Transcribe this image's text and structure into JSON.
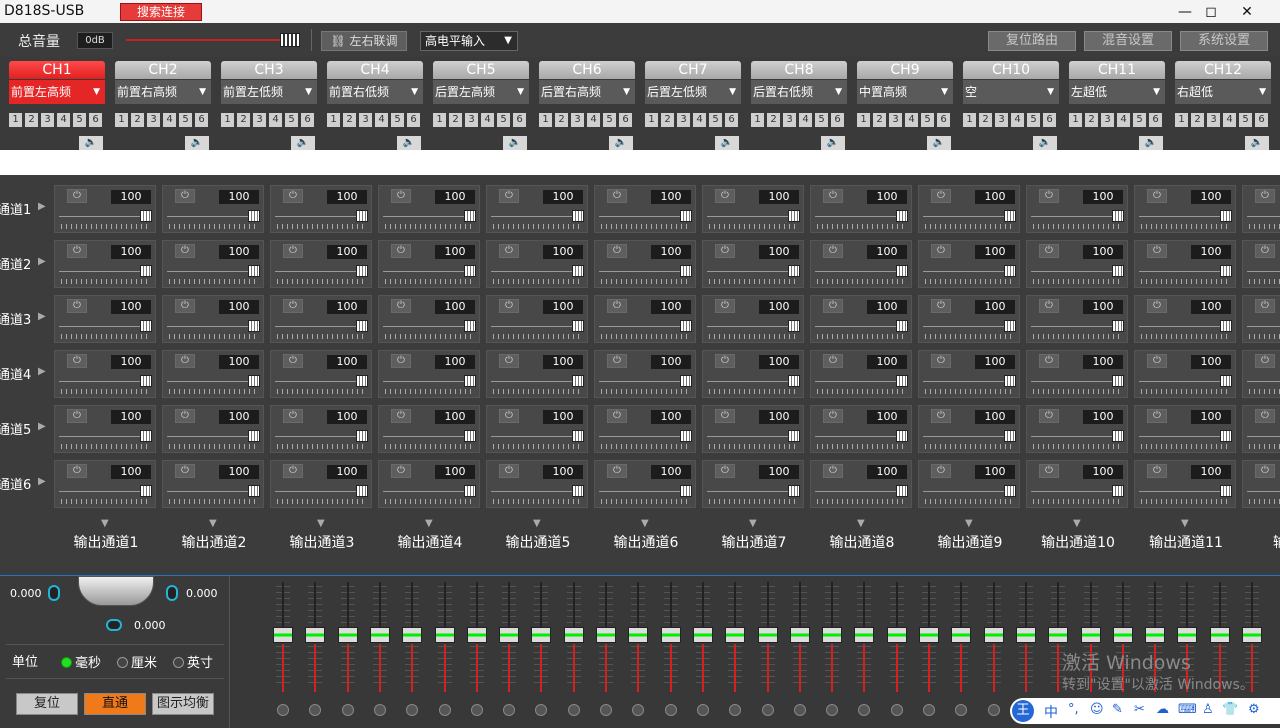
{
  "window": {
    "title": "D818S-USB",
    "search_button": "搜索连接",
    "minimize": "—",
    "maximize": "◻",
    "close": "✕"
  },
  "toolbar": {
    "master_label": "总音量",
    "master_value": "0dB",
    "link_button": "左右联调",
    "input_select": "高电平输入",
    "reset_routing": "复位路由",
    "mix_settings": "混音设置",
    "system_settings": "系统设置"
  },
  "channels": [
    {
      "name": "CH1",
      "assign": "前置左高频",
      "active": true
    },
    {
      "name": "CH2",
      "assign": "前置右高频"
    },
    {
      "name": "CH3",
      "assign": "前置左低频"
    },
    {
      "name": "CH4",
      "assign": "前置右低频"
    },
    {
      "name": "CH5",
      "assign": "后置左高频"
    },
    {
      "name": "CH6",
      "assign": "后置右高频"
    },
    {
      "name": "CH7",
      "assign": "后置左低频"
    },
    {
      "name": "CH8",
      "assign": "后置右低频"
    },
    {
      "name": "CH9",
      "assign": "中置高频"
    },
    {
      "name": "CH10",
      "assign": "空"
    },
    {
      "name": "CH11",
      "assign": "左超低"
    },
    {
      "name": "CH12",
      "assign": "右超低"
    }
  ],
  "channel_numbers": [
    "1",
    "2",
    "3",
    "4",
    "5",
    "6"
  ],
  "matrix": {
    "row_labels": [
      "通道1",
      "通道2",
      "通道3",
      "通道4",
      "通道5",
      "通道6"
    ],
    "cell_value": "100",
    "output_labels": [
      "输出通道1",
      "输出通道2",
      "输出通道3",
      "输出通道4",
      "输出通道5",
      "输出通道6",
      "输出通道7",
      "输出通道8",
      "输出通道9",
      "输出通道10",
      "输出通道11",
      "输出通"
    ]
  },
  "delay": {
    "left_value": "0.000",
    "right_value": "0.000",
    "bottom_value": "0.000",
    "unit_label": "单位",
    "units": [
      "毫秒",
      "厘米",
      "英寸"
    ],
    "selected_unit": "毫秒"
  },
  "eq_buttons": {
    "reset": "复位",
    "direct": "直通",
    "graphic_eq": "图示均衡"
  },
  "colors": {
    "accent_red": "#e52626",
    "direct_orange": "#f07a1a",
    "fader_green": "#00ee00"
  },
  "watermark": {
    "line1": "激活 Windows",
    "line2": "转到\"设置\"以激活 Windows。"
  },
  "ime": {
    "logo": "王",
    "lang": "中"
  }
}
